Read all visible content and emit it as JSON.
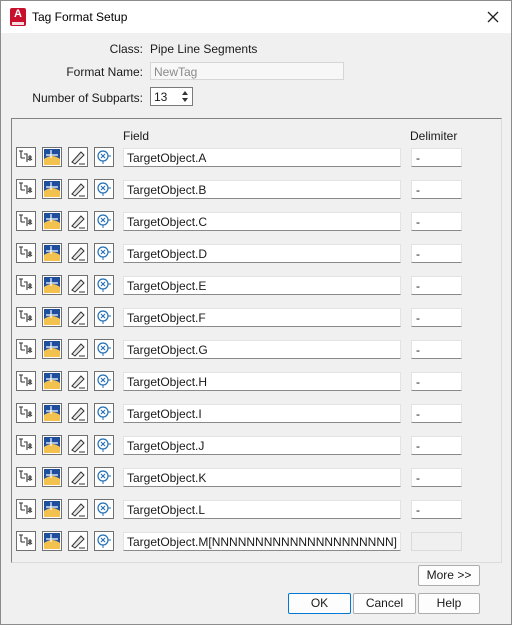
{
  "window": {
    "title": "Tag Format Setup",
    "app_icon_letter": "A"
  },
  "form": {
    "class_label": "Class:",
    "class_value": "Pipe Line Segments",
    "format_name_label": "Format Name:",
    "format_name_value": "NewTag",
    "subparts_label": "Number of Subparts:",
    "subparts_value": "13"
  },
  "table": {
    "field_header": "Field",
    "delimiter_header": "Delimiter",
    "rows": [
      {
        "field": "TargetObject.A",
        "delimiter": "-"
      },
      {
        "field": "TargetObject.B",
        "delimiter": "-"
      },
      {
        "field": "TargetObject.C",
        "delimiter": "-"
      },
      {
        "field": "TargetObject.D",
        "delimiter": "-"
      },
      {
        "field": "TargetObject.E",
        "delimiter": "-"
      },
      {
        "field": "TargetObject.F",
        "delimiter": "-"
      },
      {
        "field": "TargetObject.G",
        "delimiter": "-"
      },
      {
        "field": "TargetObject.H",
        "delimiter": "-"
      },
      {
        "field": "TargetObject.I",
        "delimiter": "-"
      },
      {
        "field": "TargetObject.J",
        "delimiter": "-"
      },
      {
        "field": "TargetObject.K",
        "delimiter": "-"
      },
      {
        "field": "TargetObject.L",
        "delimiter": "-"
      },
      {
        "field": "TargetObject.M[NNNNNNNNNNNNNNNNNNNNN]",
        "delimiter": ""
      }
    ],
    "row_icons": [
      "property-icon",
      "field-select-icon",
      "edit-icon",
      "function-icon"
    ]
  },
  "buttons": {
    "more": "More >>",
    "ok": "OK",
    "cancel": "Cancel",
    "help": "Help"
  },
  "colors": {
    "accent": "#0078d4",
    "app_red": "#c8102e",
    "field_icon_blue": "#1f4e9c",
    "field_icon_yellow": "#f2c14e"
  }
}
